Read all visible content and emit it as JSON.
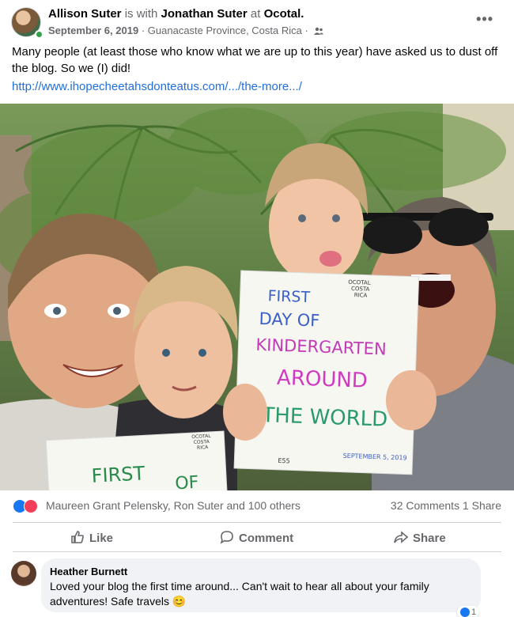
{
  "post": {
    "author": "Allison Suter",
    "with_word": "is with",
    "tagged": "Jonathan Suter",
    "at_word": "at",
    "location_tag": "Ocotal.",
    "date": "September 6, 2019",
    "separator": "·",
    "place": "Guanacaste Province, Costa Rica",
    "separator2": "·",
    "audience_icon": "friends-icon",
    "more_label": "•••",
    "text": "Many people (at least those who know what we are up to this year) have asked us to dust off the blog. So we (I) did!",
    "link": "http://www.ihopecheetahsdonteatus.com/.../the-more.../",
    "sign_main": [
      "FIRST",
      "DAY OF",
      "KINDERGARTEN",
      "AROUND",
      "THE WORLD"
    ],
    "sign_stamp": [
      "OCOTAL",
      "COSTA",
      "RICA"
    ],
    "sign_date": "SEPTEMBER 5, 2019",
    "sign_code": "E55",
    "sign2_words": [
      "FIRST",
      "OF"
    ],
    "sign2_stamp": [
      "OCOTAL",
      "COSTA",
      "RICA"
    ]
  },
  "reactions": {
    "names": "Maureen Grant Pelensky, Ron Suter and 100 others",
    "counts": "32 Comments  1 Share"
  },
  "actions": {
    "like": "Like",
    "comment": "Comment",
    "share": "Share"
  },
  "comment": {
    "name": "Heather Burnett",
    "text": "Loved your blog the first time around... Can't wait to hear all about your family adventures! Safe travels 😊",
    "like_count": "1"
  },
  "colors": {
    "link": "#216fdb",
    "muted": "#65676b",
    "like_blue": "#1877f2",
    "love_red": "#f33e58"
  }
}
